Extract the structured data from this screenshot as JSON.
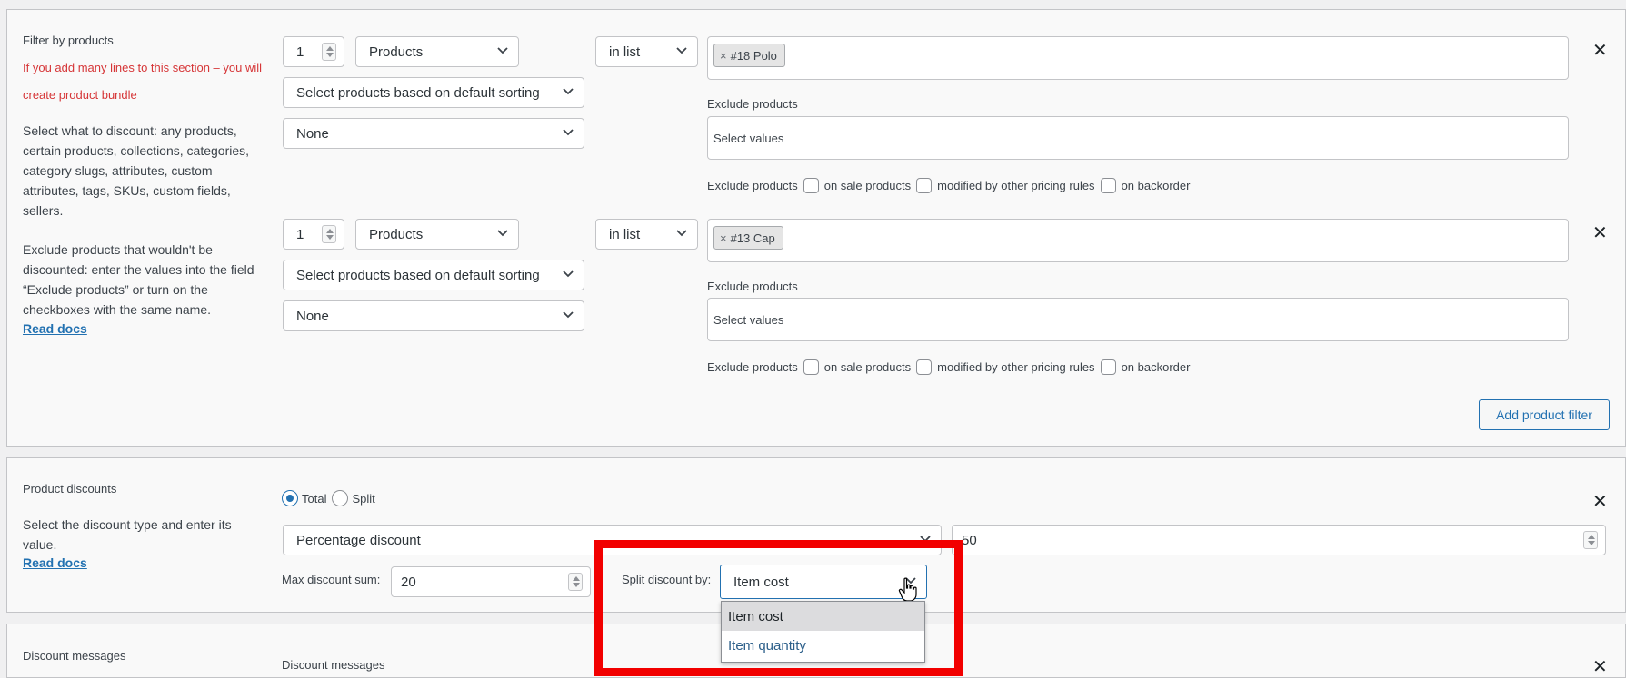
{
  "filter": {
    "title": "Filter by products",
    "warning": "If you add many lines to this section – you will create product bundle",
    "desc1": "Select what to discount: any products, certain products, collections, categories, category slugs, attributes, custom attributes, tags, SKUs, custom fields, sellers.",
    "desc2": "Exclude products that wouldn't be discounted: enter the values into the field “Exclude products” or turn on the checkboxes with the same name.",
    "read_docs": "Read docs",
    "rows": [
      {
        "qty": "1",
        "type": "Products",
        "sorting": "Select products based on default sorting",
        "extra": "None",
        "condition": "in list",
        "tag": "#18 Polo",
        "exclude_label": "Exclude products",
        "exclude_placeholder": "Select values",
        "chk_label": "Exclude products",
        "chk1": "on sale products",
        "chk2": "modified by other pricing rules",
        "chk3": "on backorder"
      },
      {
        "qty": "1",
        "type": "Products",
        "sorting": "Select products based on default sorting",
        "extra": "None",
        "condition": "in list",
        "tag": "#13 Cap",
        "exclude_label": "Exclude products",
        "exclude_placeholder": "Select values",
        "chk_label": "Exclude products",
        "chk1": "on sale products",
        "chk2": "modified by other pricing rules",
        "chk3": "on backorder"
      }
    ],
    "add_button": "Add product filter"
  },
  "discounts": {
    "title": "Product discounts",
    "desc": "Select the discount type and enter its value.",
    "read_docs": "Read docs",
    "radio_total": "Total",
    "radio_split": "Split",
    "selected_radio": "Total",
    "discount_type": "Percentage discount",
    "discount_value": "50",
    "max_label": "Max discount sum:",
    "max_value": "20",
    "split_label": "Split discount by:",
    "split_value": "Item cost",
    "split_options": [
      "Item cost",
      "Item quantity"
    ]
  },
  "messages": {
    "title": "Discount messages",
    "sub": "Discount messages"
  },
  "colors": {
    "accent": "#2271b1",
    "highlight": "#f20000",
    "warning": "#d63638"
  },
  "icons": {
    "close": "×",
    "chevron": "chevron-down-icon"
  }
}
